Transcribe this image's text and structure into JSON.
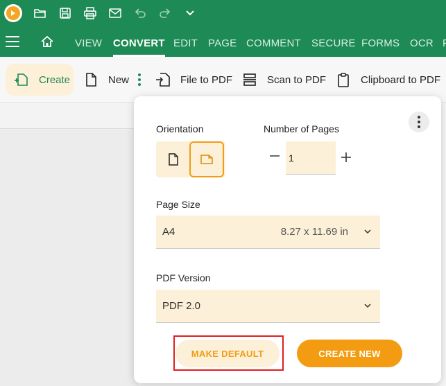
{
  "titlebar": {
    "icons": [
      "app-logo-icon",
      "open-folder-icon",
      "save-icon",
      "print-icon",
      "email-icon",
      "undo-icon",
      "redo-icon",
      "chevron-down-icon"
    ]
  },
  "menu": {
    "items": [
      {
        "label": "VIEW"
      },
      {
        "label": "CONVERT"
      },
      {
        "label": "EDIT"
      },
      {
        "label": "PAGE"
      },
      {
        "label": "COMMENT"
      },
      {
        "label": "SECURE"
      },
      {
        "label": "FORMS"
      },
      {
        "label": "OCR"
      },
      {
        "label": "F"
      }
    ],
    "active": "CONVERT"
  },
  "toolbar": {
    "create_label": "Create",
    "new_label": "New",
    "file_to_pdf_label": "File to PDF",
    "scan_to_pdf_label": "Scan to PDF",
    "clipboard_to_pdf_label": "Clipboard to PDF"
  },
  "popup": {
    "orientation_label": "Orientation",
    "orientation_selected": "landscape",
    "pages_label": "Number of Pages",
    "pages_value": "1",
    "page_size_label": "Page Size",
    "page_size_value": "A4",
    "page_size_dims": "8.27 x 11.69 in",
    "pdf_version_label": "PDF Version",
    "pdf_version_value": "PDF 2.0",
    "make_default_label": "MAKE DEFAULT",
    "create_new_label": "CREATE NEW"
  },
  "colors": {
    "brand_green": "#1e8a55",
    "accent_orange": "#f39c12",
    "field_bg": "#fdf0d8",
    "highlight_red": "#e01e1e"
  }
}
